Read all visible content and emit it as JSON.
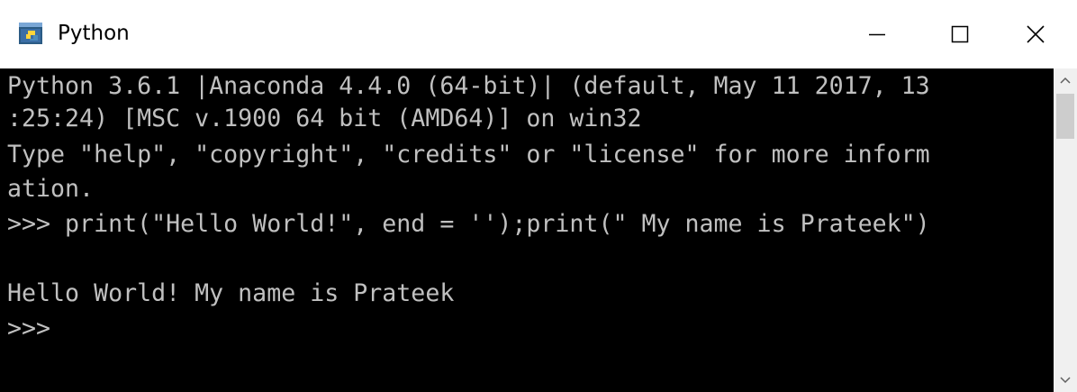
{
  "window": {
    "title": "Python",
    "icon": "python-console-icon"
  },
  "controls": {
    "minimize_icon": "minimize-icon",
    "maximize_icon": "maximize-icon",
    "close_icon": "close-icon"
  },
  "console": {
    "lines": [
      "Python 3.6.1 |Anaconda 4.4.0 (64-bit)| (default, May 11 2017, 13",
      ":25:24) [MSC v.1900 64 bit (AMD64)] on win32",
      "Type \"help\", \"copyright\", \"credits\" or \"license\" for more inform",
      "ation.",
      ">>> print(\"Hello World!\", end = '');print(\" My name is Prateek\")",
      "",
      "Hello World! My name is Prateek",
      ">>>"
    ]
  },
  "colors": {
    "console_bg": "#000000",
    "console_text": "#c0c0c0",
    "titlebar_bg": "#ffffff"
  }
}
